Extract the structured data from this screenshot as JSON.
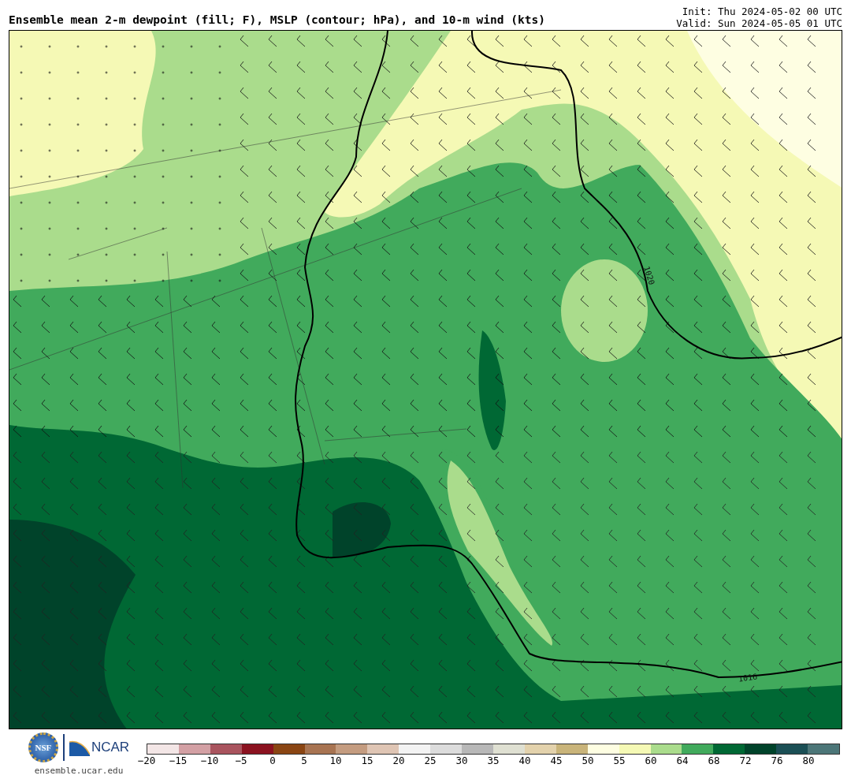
{
  "title": "Ensemble mean 2-m dewpoint (fill; F), MSLP (contour; hPa), and 10-m wind (kts)",
  "init": "Init: Thu 2024-05-02 00 UTC",
  "valid": "Valid: Sun 2024-05-05 01 UTC",
  "map": {
    "contour_labels": [
      "1020",
      "1016"
    ]
  },
  "logos": {
    "nsf": "NSF",
    "ncar": "NCAR"
  },
  "site": "ensemble.ucar.edu",
  "colorbar": {
    "bins": [
      {
        "color": "#f3e6e6"
      },
      {
        "color": "#d3a0a4"
      },
      {
        "color": "#a9545e"
      },
      {
        "color": "#8b1220"
      },
      {
        "color": "#8a4513"
      },
      {
        "color": "#a87452"
      },
      {
        "color": "#c49c80"
      },
      {
        "color": "#dfc5b4"
      },
      {
        "color": "#f3f3f3"
      },
      {
        "color": "#dcdcdc"
      },
      {
        "color": "#b8b8b8"
      },
      {
        "color": "#dfe0d2"
      },
      {
        "color": "#e3d2ac"
      },
      {
        "color": "#c9b47a"
      },
      {
        "color": "#fefee2"
      },
      {
        "color": "#f5f9b5"
      },
      {
        "color": "#aadc8c"
      },
      {
        "color": "#41aa5c"
      },
      {
        "color": "#006834"
      },
      {
        "color": "#00432a"
      },
      {
        "color": "#1b4f55"
      },
      {
        "color": "#4c7678"
      }
    ],
    "ticks": [
      "−20",
      "−15",
      "−10",
      "−5",
      "0",
      "5",
      "10",
      "15",
      "20",
      "25",
      "30",
      "35",
      "40",
      "45",
      "50",
      "55",
      "60",
      "64",
      "68",
      "72",
      "76",
      "80"
    ]
  }
}
